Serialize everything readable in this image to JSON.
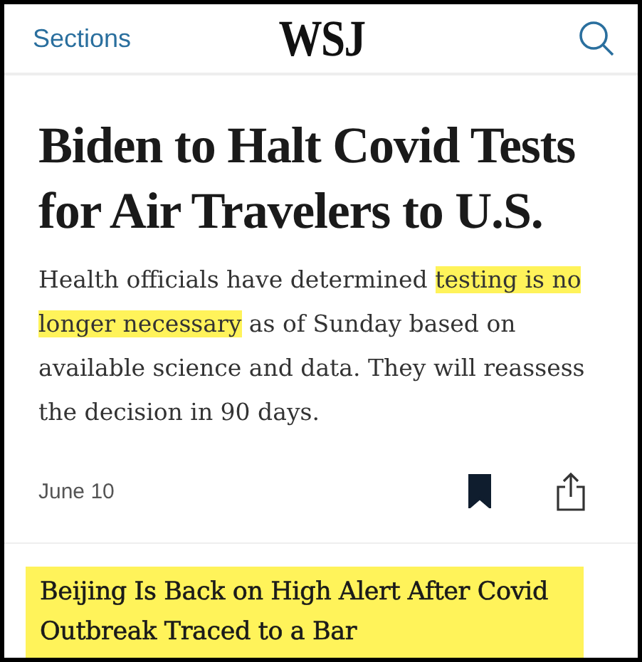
{
  "header": {
    "sections_link": "Sections",
    "logo": "WSJ"
  },
  "article": {
    "headline": "Biden to Halt Covid Tests for Air Travelers to U.S.",
    "summary": [
      {
        "text": "Health officials have determined ",
        "highlighted": false
      },
      {
        "text": "testing is no longer necessary",
        "highlighted": true
      },
      {
        "text": " as of Sunday based on available science and data. They will reassess the decision in 90 days.",
        "highlighted": false
      }
    ],
    "date": "June 10",
    "saved": true
  },
  "next_article": {
    "headline": "Beijing Is Back on High Alert After Covid Outbreak Traced to a Bar",
    "highlighted": true
  }
}
